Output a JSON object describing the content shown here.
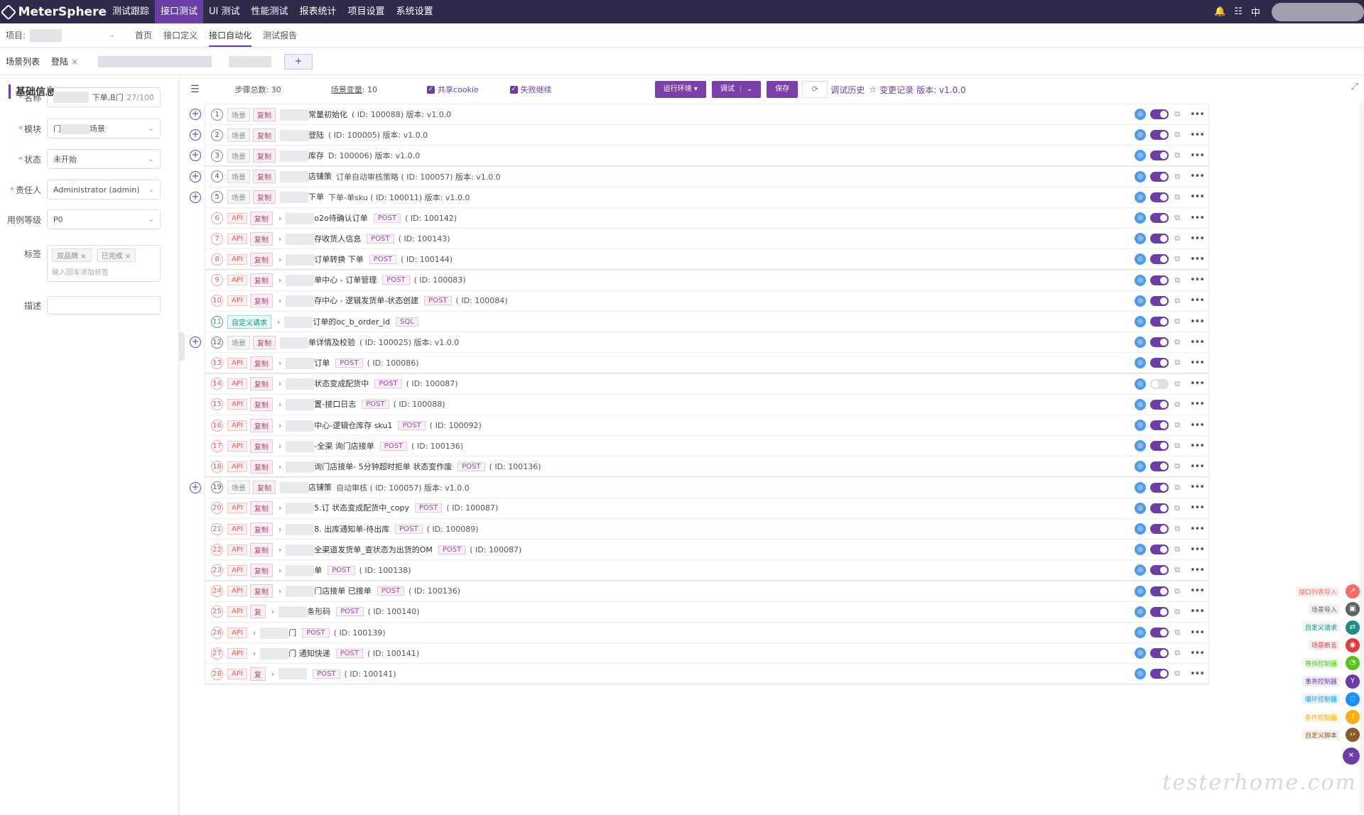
{
  "app": {
    "name": "MeterSphere"
  },
  "topnav": {
    "items": [
      "测试跟踪",
      "接口测试",
      "UI 测试",
      "性能测试",
      "报表统计",
      "项目设置",
      "系统设置"
    ],
    "active_index": 1,
    "right_text": "中"
  },
  "project_bar": {
    "label": "项目:",
    "subnav": [
      "首页",
      "接口定义",
      "接口自动化",
      "测试报告"
    ],
    "active_index": 2
  },
  "tabs": {
    "items": [
      "场景列表",
      "登陆"
    ],
    "close_glyph": "×",
    "add_glyph": "+"
  },
  "basic_info": {
    "title": "基础信息",
    "name_label": "名称",
    "name_value": "下单,B门",
    "name_count": "27/100",
    "module_label": "模块",
    "module_value_prefix": "门",
    "module_value_suffix": "场景",
    "status_label": "状态",
    "status_value": "未开始",
    "owner_label": "责任人",
    "owner_value": "Administrator (admin)",
    "level_label": "用例等级",
    "level_value": "P0",
    "tags_label": "标签",
    "tags": [
      "双品牌",
      "已完成"
    ],
    "tag_placeholder": "输入回车添加标签",
    "desc_label": "描述"
  },
  "toolbar": {
    "steps_total": "步骤总数:  30",
    "scene_vars_label": "场景变量",
    "scene_vars_value": ":  10",
    "share_cookie": "共享cookie",
    "fail_continue": "失败继续",
    "run_env": "运行环境",
    "debug": "调试",
    "save": "保存",
    "debug_history": "调试历史",
    "change_log": "变更记录",
    "version": "版本: v1.0.0"
  },
  "steps": [
    {
      "n": "1",
      "kind": "scene",
      "type": "场景",
      "copy": "复制",
      "name": "常量初始化",
      "id": "( ID: 100088)  版本: v1.0.0",
      "method": "",
      "on": true,
      "plus": true
    },
    {
      "n": "2",
      "kind": "scene",
      "type": "场景",
      "copy": "复制",
      "name": "登陆",
      "id": "( ID: 100005)  版本: v1.0.0",
      "method": "",
      "on": true,
      "plus": true
    },
    {
      "n": "3",
      "kind": "scene",
      "type": "场景",
      "copy": "复制",
      "name": "库存",
      "id": "D: 100006)  版本: v1.0.0",
      "method": "",
      "on": true,
      "plus": true
    },
    {
      "n": "4",
      "kind": "scene",
      "type": "场景",
      "copy": "复制",
      "name": "店铺策",
      "id": "订单自动审核策略 ( ID: 100057)  版本: v1.0.0",
      "method": "",
      "on": true,
      "plus": true
    },
    {
      "n": "5",
      "kind": "scene",
      "type": "场景",
      "copy": "复制",
      "name": "下单",
      "id": "下单-单sku ( ID: 100011)  版本: v1.0.0",
      "method": "",
      "on": true,
      "plus": true
    },
    {
      "n": "6",
      "kind": "api",
      "type": "API",
      "copy": "复制",
      "name": "o2o待确认订单",
      "id": "( ID: 100142)",
      "method": "POST",
      "on": true,
      "plus": false
    },
    {
      "n": "7",
      "kind": "api",
      "type": "API",
      "copy": "复制",
      "name": "存收货人信息",
      "id": "( ID: 100143)",
      "method": "POST",
      "on": true,
      "plus": false
    },
    {
      "n": "8",
      "kind": "api",
      "type": "API",
      "copy": "复制",
      "name": "订单转换 下单",
      "id": "( ID: 100144)",
      "method": "POST",
      "on": true,
      "plus": false
    },
    {
      "n": "9",
      "kind": "api",
      "type": "API",
      "copy": "复制",
      "name": "单中心 - 订单管理",
      "id": "( ID: 100083)",
      "method": "POST",
      "on": true,
      "plus": false
    },
    {
      "n": "10",
      "kind": "api",
      "type": "API",
      "copy": "复制",
      "name": "存中心 - 逻辑发货单-状态创建",
      "id": "( ID: 100084)",
      "method": "POST",
      "on": true,
      "plus": false
    },
    {
      "n": "11",
      "kind": "custom",
      "type": "自定义请求",
      "copy": "",
      "name": "订单的oc_b_order_id",
      "id": "",
      "method": "SQL",
      "on": true,
      "plus": false
    },
    {
      "n": "12",
      "kind": "scene",
      "type": "场景",
      "copy": "复制",
      "name": "单详情及校验",
      "id": "( ID: 100025)  版本: v1.0.0",
      "method": "",
      "on": true,
      "plus": true
    },
    {
      "n": "13",
      "kind": "api",
      "type": "API",
      "copy": "复制",
      "name": "订单",
      "id": "( ID: 100086)",
      "method": "POST",
      "on": true,
      "plus": false
    },
    {
      "n": "14",
      "kind": "api",
      "type": "API",
      "copy": "复制",
      "name": "状态变成配货中",
      "id": "( ID: 100087)",
      "method": "POST",
      "on": false,
      "plus": false
    },
    {
      "n": "15",
      "kind": "api",
      "type": "API",
      "copy": "复制",
      "name": "置-接口日志",
      "id": "( ID: 100088)",
      "method": "POST",
      "on": true,
      "plus": false
    },
    {
      "n": "16",
      "kind": "api",
      "type": "API",
      "copy": "复制",
      "name": "中心-逻辑仓库存 sku1",
      "id": "( ID: 100092)",
      "method": "POST",
      "on": true,
      "plus": false
    },
    {
      "n": "17",
      "kind": "api",
      "type": "API",
      "copy": "复制",
      "name": "-全渠 询门店接单",
      "id": "( ID: 100136)",
      "method": "POST",
      "on": true,
      "plus": false
    },
    {
      "n": "18",
      "kind": "api",
      "type": "API",
      "copy": "复制",
      "name": "询门店接单- 5分钟超时拒单 状态变作废",
      "id": "( ID: 100136)",
      "method": "POST",
      "on": true,
      "plus": false
    },
    {
      "n": "19",
      "kind": "scene",
      "type": "场景",
      "copy": "复制",
      "name": "店铺策",
      "id": "自动审核 ( ID: 100057)  版本: v1.0.0",
      "method": "",
      "on": true,
      "plus": true
    },
    {
      "n": "20",
      "kind": "api",
      "type": "API",
      "copy": "复制",
      "name": "5.订 状态变成配货中_copy",
      "id": "( ID: 100087)",
      "method": "POST",
      "on": true,
      "plus": false
    },
    {
      "n": "21",
      "kind": "api",
      "type": "API",
      "copy": "复制",
      "name": "8. 出库通知单-待出库",
      "id": "( ID: 100089)",
      "method": "POST",
      "on": true,
      "plus": false
    },
    {
      "n": "22",
      "kind": "api",
      "type": "API",
      "copy": "复制",
      "name": "全渠道发货单_查状态为出货的OM",
      "id": "( ID: 100087)",
      "method": "POST",
      "on": true,
      "plus": false
    },
    {
      "n": "23",
      "kind": "api",
      "type": "API",
      "copy": "复制",
      "name": "单",
      "id": "( ID: 100138)",
      "method": "POST",
      "on": true,
      "plus": false
    },
    {
      "n": "24",
      "kind": "api",
      "type": "API",
      "copy": "复制",
      "name": "门店接单 已接单",
      "id": "( ID: 100136)",
      "method": "POST",
      "on": true,
      "plus": false
    },
    {
      "n": "25",
      "kind": "api",
      "type": "API",
      "copy": "复",
      "name": "条形码",
      "id": "( ID: 100140)",
      "method": "POST",
      "on": true,
      "plus": false
    },
    {
      "n": "26",
      "kind": "api",
      "type": "API",
      "copy": "",
      "name": "门",
      "id": "( ID: 100139)",
      "method": "POST",
      "on": true,
      "plus": false
    },
    {
      "n": "27",
      "kind": "api",
      "type": "API",
      "copy": "",
      "name": "门 通知快递",
      "id": "( ID: 100141)",
      "method": "POST",
      "on": true,
      "plus": false
    },
    {
      "n": "28",
      "kind": "api",
      "type": "API",
      "copy": "复",
      "name": "",
      "id": "( ID: 100141)",
      "method": "POST",
      "on": true,
      "plus": false
    }
  ],
  "right_tools": [
    {
      "label": "接口列表导入",
      "color": "#f56c6c"
    },
    {
      "label": "场景导入",
      "color": "#606266"
    },
    {
      "label": "自定义请求",
      "color": "#1d8f84"
    },
    {
      "label": "场景断言",
      "color": "#e03a3a"
    },
    {
      "label": "等待控制器",
      "color": "#52c41a"
    },
    {
      "label": "事务控制器",
      "color": "#6a3ea6"
    },
    {
      "label": "循环控制器",
      "color": "#1890ff"
    },
    {
      "label": "条件控制器",
      "color": "#faad14"
    },
    {
      "label": "自定义脚本",
      "color": "#8b5a2b"
    }
  ],
  "watermark": "testerhome.com"
}
